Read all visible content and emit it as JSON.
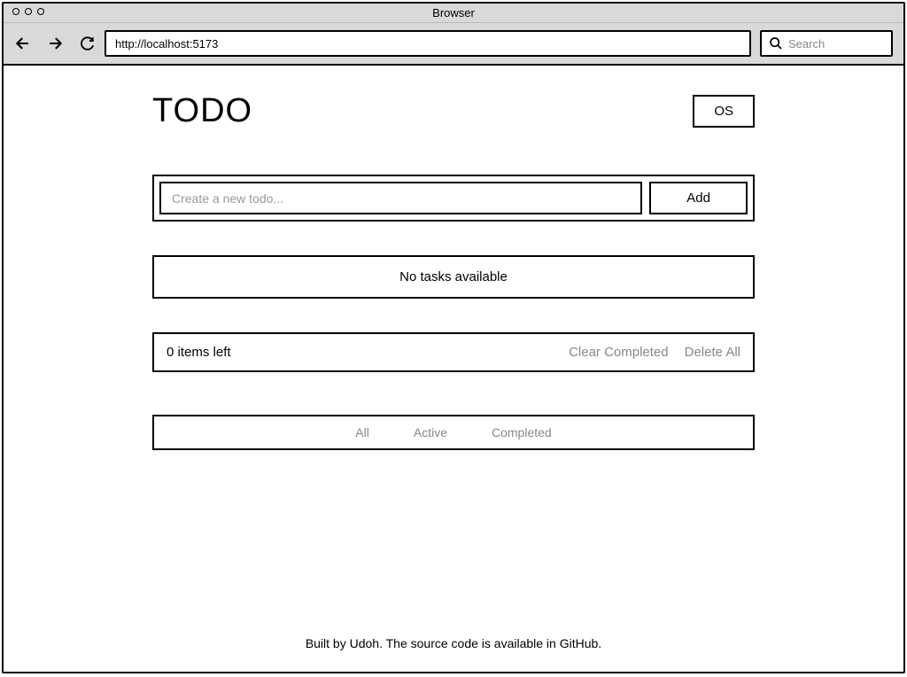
{
  "browser": {
    "title": "Browser",
    "url": "http://localhost:5173",
    "search_placeholder": "Search"
  },
  "header": {
    "logo": "TODO",
    "os_button": "OS"
  },
  "input": {
    "placeholder": "Create a new todo...",
    "add_label": "Add"
  },
  "empty": {
    "message": "No tasks available"
  },
  "status": {
    "items_left": "0 items left",
    "clear_completed": "Clear Completed",
    "delete_all": "Delete All"
  },
  "filters": {
    "all": "All",
    "active": "Active",
    "completed": "Completed"
  },
  "footer": {
    "text": "Built by Udoh. The source code is available in GitHub."
  }
}
